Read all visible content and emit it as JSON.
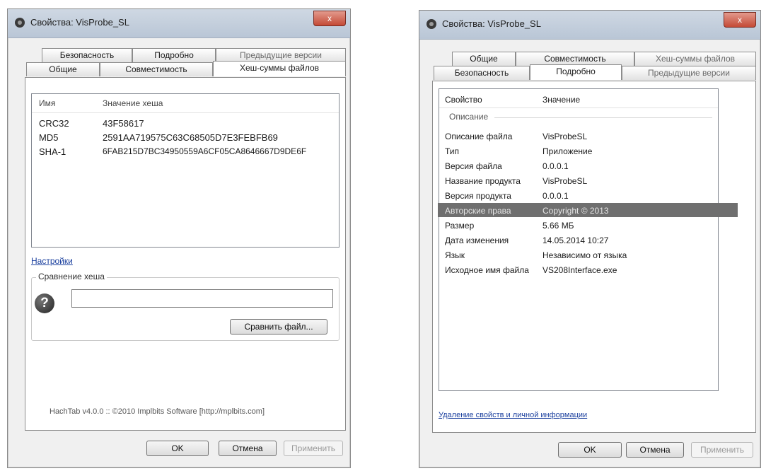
{
  "left": {
    "title": "Свойства: VisProbe_SL",
    "close": "x",
    "tabs_top": [
      "Безопасность",
      "Подробно",
      "Предыдущие версии"
    ],
    "tabs_bottom": [
      "Общие",
      "Совместимость",
      "Хеш-суммы файлов"
    ],
    "hash_table": {
      "headers": [
        "Имя",
        "Значение хеша"
      ],
      "rows": [
        {
          "name": "CRC32",
          "value": "43F58617"
        },
        {
          "name": "MD5",
          "value": "2591AA719575C63C68505D7E3FEBFB69"
        },
        {
          "name": "SHA-1",
          "value": "6FAB215D7BC34950559A6CF05CA8646667D9DE6F"
        }
      ]
    },
    "settings_link": "Настройки",
    "compare_group": "Сравнение хеша",
    "help_icon": "?",
    "compare_input": "",
    "compare_button": "Сравнить файл...",
    "footer": "HachTab v4.0.0 :: ©2010 Implbits Software [http://mplbits.com]",
    "buttons": {
      "ok": "OK",
      "cancel": "Отмена",
      "apply": "Применить"
    }
  },
  "right": {
    "title": "Свойства: VisProbe_SL",
    "tabs_top": [
      "Общие",
      "Совместимость",
      "Хеш-суммы файлов"
    ],
    "tabs_bottom": [
      "Безопасность",
      "Подробно",
      "Предыдущие версии"
    ],
    "props": {
      "headers": [
        "Свойство",
        "Значение"
      ],
      "section": "Описание",
      "rows": [
        {
          "name": "Описание файла",
          "value": "VisProbeSL"
        },
        {
          "name": "Тип",
          "value": "Приложение"
        },
        {
          "name": "Версия файла",
          "value": "0.0.0.1"
        },
        {
          "name": "Название продукта",
          "value": "VisProbeSL"
        },
        {
          "name": "Версия продукта",
          "value": "0.0.0.1"
        },
        {
          "name": "Авторские права",
          "value": "Copyright © 2013"
        },
        {
          "name": "Размер",
          "value": "5.66 МБ"
        },
        {
          "name": "Дата изменения",
          "value": "14.05.2014 10:27"
        },
        {
          "name": "Язык",
          "value": "Независимо от языка"
        },
        {
          "name": "Исходное имя файла",
          "value": "VS208Interface.exe"
        }
      ]
    },
    "remove_link": "Удаление свойств и личной информации",
    "buttons": {
      "ok": "OK",
      "cancel": "Отмена",
      "apply": "Применить"
    }
  }
}
